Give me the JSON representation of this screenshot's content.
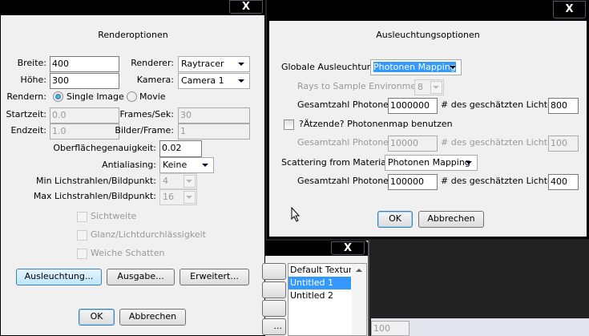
{
  "render_dialog": {
    "title": "Renderoptionen",
    "close": "X",
    "breite_label": "Breite:",
    "breite": "400",
    "hoehe_label": "Höhe:",
    "hoehe": "300",
    "renderer_label": "Renderer:",
    "renderer": "Raytracer",
    "kamera_label": "Kamera:",
    "kamera": "Camera 1",
    "rendern_label": "Rendern:",
    "single_image": "Single Image",
    "movie": "Movie",
    "startzeit_label": "Startzeit:",
    "startzeit": "0.0",
    "endzeit_label": "Endzeit:",
    "endzeit": "1.0",
    "fps_label": "Frames/Sek:",
    "fps": "30",
    "bpf_label": "Bilder/Frame:",
    "bpf": "1",
    "surface_label": "Oberflächegenauigkeit:",
    "surface": "0.02",
    "aa_label": "Antialiasing:",
    "aa": "Keine",
    "min_label": "Min Lichstrahlen/Bildpunkt:",
    "min": "4",
    "max_label": "Max Lichstrahlen/Bildpunkt:",
    "max": "16",
    "chk_sicht": "Sichtweite",
    "chk_glanz": "Glanz/Lichtdurchlässigkeit",
    "chk_weich": "Weiche Schatten",
    "btn_ausleuchtung": "Ausleuchtung...",
    "btn_ausgabe": "Ausgabe...",
    "btn_erweitert": "Erweitert...",
    "ok": "OK",
    "cancel": "Abbrechen"
  },
  "light_dialog": {
    "title": "Ausleuchtungsoptionen",
    "close": "X",
    "global_label": "Globale Ausleuchtung:",
    "global": "Photonen Mapping",
    "rays_label": "Rays to Sample Environment:",
    "rays": "8",
    "gp_label": "Gesamtzahl Photonen:",
    "est_label": "# des geschätzten Lichtes:",
    "gp1": "1000000",
    "est1": "800",
    "caustic_label": "?Ätzende? Photonenmap benutzen",
    "gp2": "10000",
    "est2": "100",
    "scatter_label": "Scattering from Materials:",
    "scatter": "Photonen Mapping",
    "gp3": "100000",
    "est3": "400",
    "ok": "OK",
    "cancel": "Abbrechen"
  },
  "texture_window": {
    "close": "X",
    "stub_label": "...",
    "items": [
      "Default Texture",
      "Untitled 1",
      "Untitled 2"
    ]
  },
  "bottom_field": "100"
}
